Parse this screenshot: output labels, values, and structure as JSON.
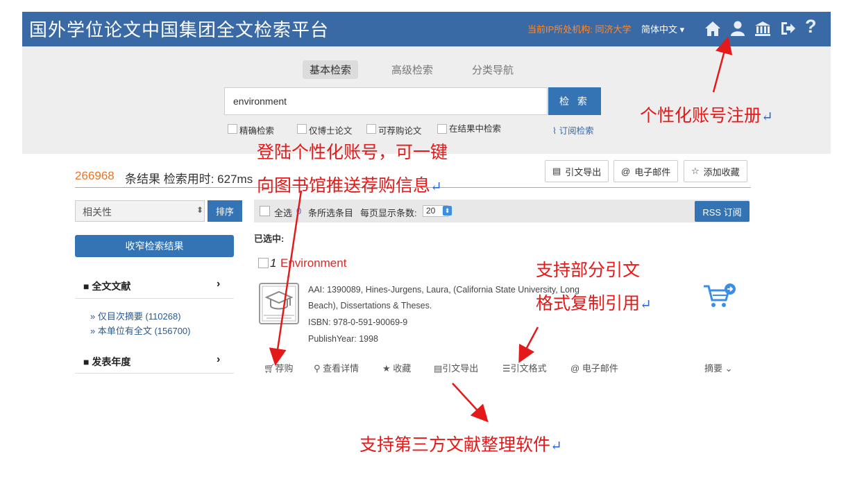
{
  "header": {
    "title": "国外学位论文中国集团全文检索平台",
    "ip_label": "当前IP所处机构: 同济大学",
    "language": "简体中文 ▾"
  },
  "search": {
    "tabs": [
      "基本检索",
      "高级检索",
      "分类导航"
    ],
    "value": "environment",
    "button": "检 索",
    "options": [
      "精确检索",
      "仅博士论文",
      "可荐购论文",
      "在结果中检索"
    ],
    "subscribe": "订阅检索"
  },
  "results": {
    "count": "266968",
    "label": "条结果  检索用时: 627ms",
    "actions": [
      "引文导出",
      "电子邮件",
      "添加收藏"
    ]
  },
  "sidebar": {
    "sort_value": "相关性",
    "sort_button": "排序",
    "narrow_button": "收窄检索结果",
    "facets": [
      {
        "label": "全文文献",
        "subitems": [
          "» 仅目次摘要 (110268)",
          "» 本单位有全文 (156700)"
        ]
      },
      {
        "label": "发表年度",
        "subitems": []
      }
    ]
  },
  "toolbar": {
    "select_all": "全选",
    "selected_count": "0",
    "items_label": "条所选条目",
    "per_page_label": "每页显示条数:",
    "per_page_value": "20",
    "rss": "RSS 订阅",
    "selected_label": "已选中:"
  },
  "item": {
    "number": "1",
    "title": "Environment",
    "aai_line1": "AAI: 1390089, Hines-Jurgens, Laura, (California State University, Long",
    "aai_line2": "Beach), Dissertations & Theses.",
    "isbn": "ISBN: 978-0-591-90069-9",
    "year": "PublishYear: 1998",
    "actions": [
      "荐购",
      "查看详情",
      "收藏",
      "引文导出",
      "引文格式",
      "电子邮件"
    ],
    "abstract": "摘要 ⌄"
  },
  "annotations": {
    "account_register": "个性化账号注册",
    "login_line1": "登陆个性化账号，可一键",
    "login_line2": "向图书馆推送荐购信息",
    "citation_line1": "支持部分引文",
    "citation_line2": "格式复制引用",
    "third_party": "支持第三方文献整理软件"
  },
  "colors": {
    "header_bg": "#3a6aa6",
    "primary_button": "#3474b4",
    "result_count": "#e8762a",
    "item_title": "#d42a2a",
    "annotation": "#e41a1a"
  },
  "icons": [
    "home-icon",
    "user-icon",
    "library-icon",
    "logout-icon",
    "help-icon",
    "search-icon",
    "star-icon",
    "cart-icon",
    "email-icon",
    "document-icon",
    "rss-icon"
  ]
}
